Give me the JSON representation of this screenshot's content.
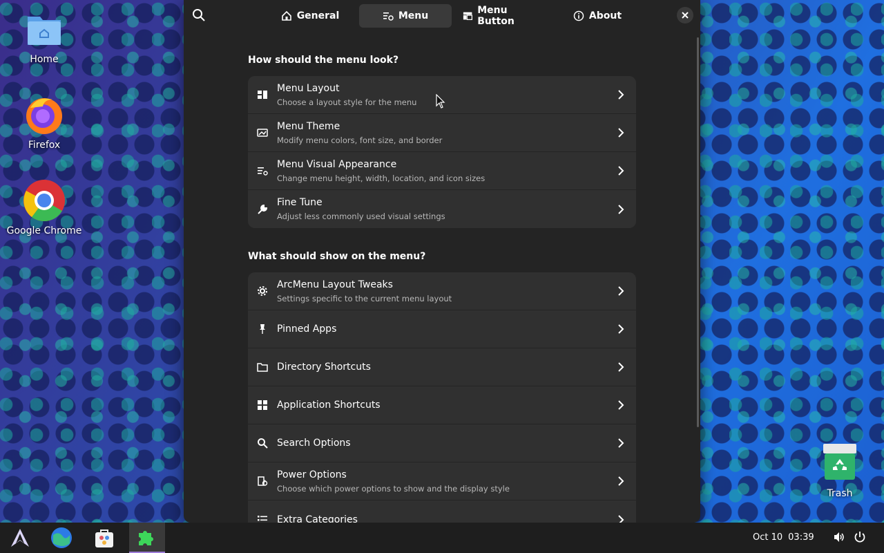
{
  "desktop": {
    "icons": [
      {
        "label": "Home"
      },
      {
        "label": "Firefox"
      },
      {
        "label": "Google Chrome"
      },
      {
        "label": "Trash"
      }
    ]
  },
  "window": {
    "tabs": [
      {
        "label": "General",
        "icon": "home-icon"
      },
      {
        "label": "Menu",
        "icon": "menu-settings-icon"
      },
      {
        "label": "Menu Button",
        "icon": "panel-icon"
      },
      {
        "label": "About",
        "icon": "info-icon"
      }
    ],
    "active_tab": "Menu",
    "sections": [
      {
        "title": "How should the menu look?",
        "rows": [
          {
            "title": "Menu Layout",
            "subtitle": "Choose a layout style for the menu",
            "icon": "layout-icon"
          },
          {
            "title": "Menu Theme",
            "subtitle": "Modify menu colors, font size, and border",
            "icon": "theme-icon"
          },
          {
            "title": "Menu Visual Appearance",
            "subtitle": "Change menu height, width, location, and icon sizes",
            "icon": "appearance-icon"
          },
          {
            "title": "Fine Tune",
            "subtitle": "Adjust less commonly used visual settings",
            "icon": "wrench-icon"
          }
        ]
      },
      {
        "title": "What should show on the menu?",
        "rows": [
          {
            "title": "ArcMenu Layout Tweaks",
            "subtitle": "Settings specific to the current menu layout",
            "icon": "gear-icon"
          },
          {
            "title": "Pinned Apps",
            "subtitle": "",
            "icon": "pin-icon"
          },
          {
            "title": "Directory Shortcuts",
            "subtitle": "",
            "icon": "folder-icon"
          },
          {
            "title": "Application Shortcuts",
            "subtitle": "",
            "icon": "grid-icon"
          },
          {
            "title": "Search Options",
            "subtitle": "",
            "icon": "search-icon"
          },
          {
            "title": "Power Options",
            "subtitle": "Choose which power options to show and the display style",
            "icon": "power-options-icon"
          },
          {
            "title": "Extra Categories",
            "subtitle": "",
            "icon": "list-icon"
          }
        ]
      }
    ]
  },
  "taskbar": {
    "apps": [
      "arcmenu-logo-icon",
      "globe-browser-icon",
      "software-store-icon",
      "extensions-icon"
    ],
    "clock_date": "Oct 10",
    "clock_time": "03:39"
  },
  "colors": {
    "accent": "#9d7cd8",
    "window_bg": "#242424",
    "row_bg": "#303030"
  }
}
